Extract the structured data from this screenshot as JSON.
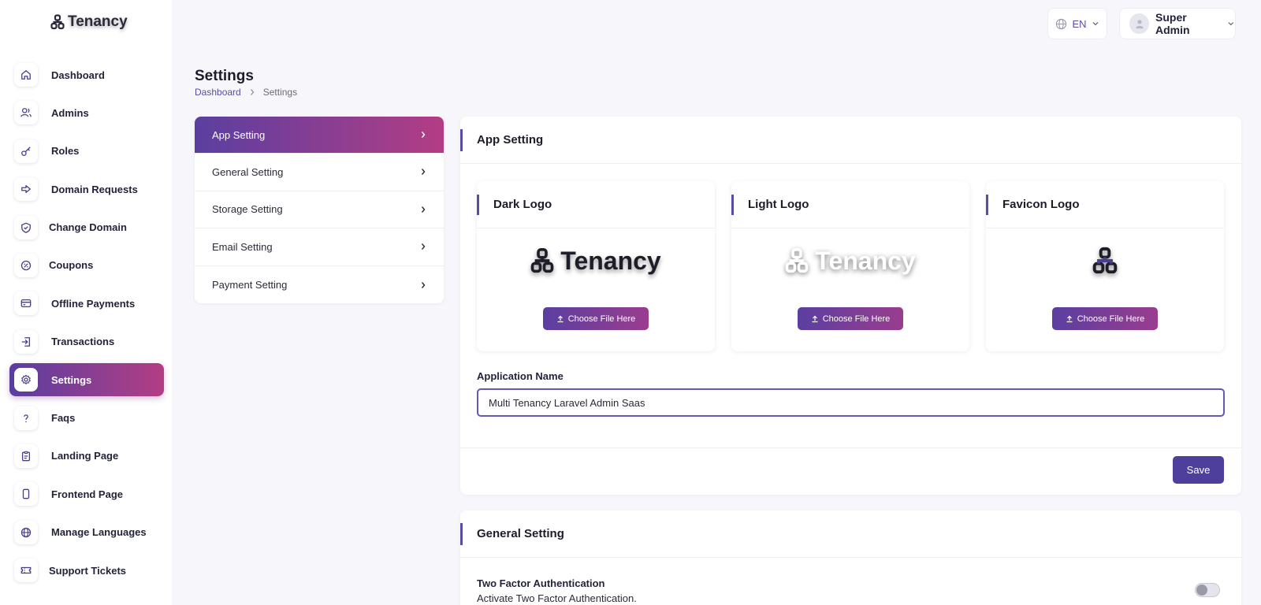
{
  "brand": {
    "name": "Tenancy"
  },
  "topbar": {
    "language": "EN",
    "user_name": "Super Admin"
  },
  "sidebar": {
    "items": [
      {
        "label": "Dashboard",
        "icon": "home-icon"
      },
      {
        "label": "Admins",
        "icon": "users-icon"
      },
      {
        "label": "Roles",
        "icon": "key-icon"
      },
      {
        "label": "Domain Requests",
        "icon": "arrow-right-icon"
      },
      {
        "label": "Change Domain",
        "icon": "shield-check-icon"
      },
      {
        "label": "Coupons",
        "icon": "percent-icon"
      },
      {
        "label": "Offline Payments",
        "icon": "card-icon"
      },
      {
        "label": "Transactions",
        "icon": "login-icon"
      },
      {
        "label": "Settings",
        "icon": "gear-icon",
        "active": true
      },
      {
        "label": "Faqs",
        "icon": "question-icon"
      },
      {
        "label": "Landing Page",
        "icon": "clipboard-icon"
      },
      {
        "label": "Frontend Page",
        "icon": "phone-icon"
      },
      {
        "label": "Manage Languages",
        "icon": "globe-icon"
      },
      {
        "label": "Support Tickets",
        "icon": "ticket-icon"
      }
    ]
  },
  "page": {
    "title": "Settings",
    "breadcrumb": {
      "home": "Dashboard",
      "current": "Settings"
    }
  },
  "settings_menu": {
    "items": [
      "App Setting",
      "General Setting",
      "Storage Setting",
      "Email Setting",
      "Payment Setting"
    ],
    "active_index": 0
  },
  "app_setting": {
    "title": "App Setting",
    "logos": [
      {
        "title": "Dark Logo",
        "preview_text": "Tenancy",
        "style": "dark"
      },
      {
        "title": "Light Logo",
        "preview_text": "Tenancy",
        "style": "light"
      },
      {
        "title": "Favicon Logo",
        "preview_text": "",
        "style": "icon"
      }
    ],
    "choose_label": "Choose File Here",
    "app_name_label": "Application Name",
    "app_name_value": "Multi Tenancy Laravel Admin Saas",
    "save_label": "Save"
  },
  "general_setting": {
    "title": "General Setting",
    "tfa_title": "Two Factor Authentication",
    "tfa_desc": "Activate Two Factor Authentication.",
    "tfa_enabled": false
  },
  "colors": {
    "accent": "#5a4ca0",
    "gradient_start": "#5a3fa0",
    "gradient_end": "#b33d84"
  }
}
